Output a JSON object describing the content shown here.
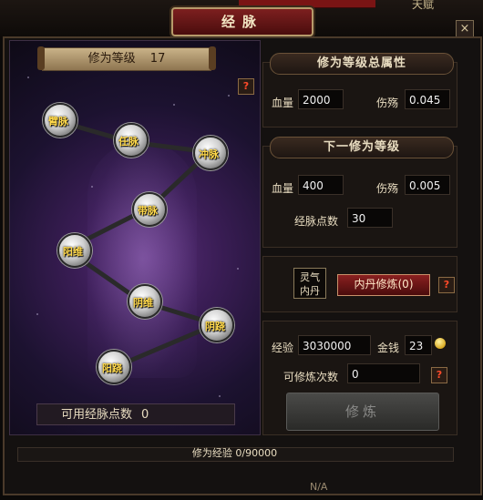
{
  "window": {
    "title": "经脉",
    "top_right_text": "天赋",
    "close_label": "×"
  },
  "level": {
    "label": "修为等级",
    "value": "17"
  },
  "help_icon": "?",
  "meridian_nodes": [
    {
      "id": "bi",
      "label": "臂脉"
    },
    {
      "id": "ren",
      "label": "任脉"
    },
    {
      "id": "chong",
      "label": "冲脉"
    },
    {
      "id": "dai",
      "label": "带脉"
    },
    {
      "id": "yangwei",
      "label": "阳维"
    },
    {
      "id": "yinwei",
      "label": "阴维"
    },
    {
      "id": "yinqiao",
      "label": "阴跷"
    },
    {
      "id": "yangqiao",
      "label": "阳跷"
    }
  ],
  "available_points": {
    "label": "可用经脉点数",
    "value": "0"
  },
  "total_attributes": {
    "title": "修为等级总属性",
    "hp_label": "血量",
    "hp_value": "2000",
    "dodge_label": "伤殇",
    "dodge_value": "0.045"
  },
  "next_level": {
    "title": "下一修为等级",
    "hp_label": "血量",
    "hp_value": "400",
    "dodge_label": "伤殇",
    "dodge_value": "0.005",
    "points_label": "经脉点数",
    "points_value": "30"
  },
  "neidan": {
    "elixir_label_line1": "灵气",
    "elixir_label_line2": "内丹",
    "refine_button": "内丹修炼(0)"
  },
  "resources": {
    "exp_label": "经验",
    "exp_value": "3030000",
    "gold_label": "金钱",
    "gold_value": "23",
    "times_label": "可修炼次数",
    "times_value": "0"
  },
  "cultivate_button": "修炼",
  "progress": {
    "text": "修为经验 0/90000",
    "fraction": 0.0
  },
  "bottom_text": "N/A",
  "icons": [
    "close-icon",
    "help-icon",
    "coin-icon"
  ]
}
